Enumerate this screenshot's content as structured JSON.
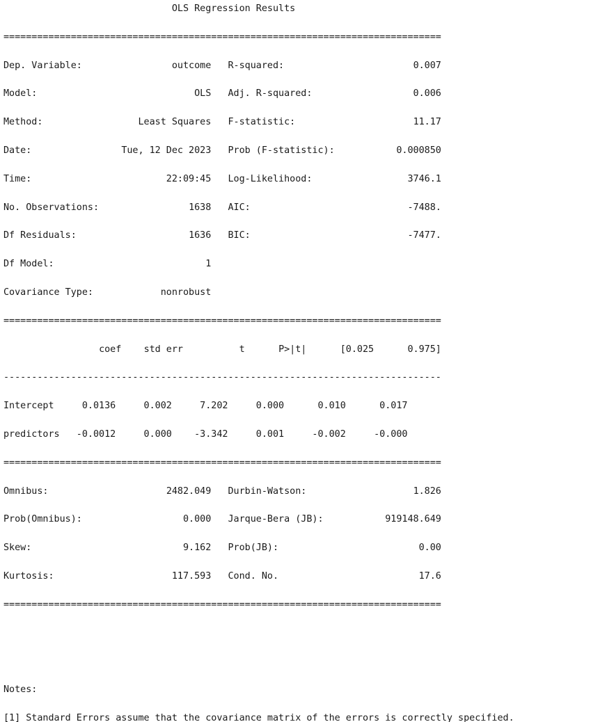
{
  "title": "OLS Regression Results",
  "separator_double": "==============================================================================",
  "separator_single": "------------------------------------------------------------------------------",
  "summary": {
    "left": [
      {
        "label": "Dep. Variable:",
        "value": "outcome"
      },
      {
        "label": "Model:",
        "value": "OLS"
      },
      {
        "label": "Method:",
        "value": "Least Squares"
      },
      {
        "label": "Date:",
        "value": "Tue, 12 Dec 2023"
      },
      {
        "label": "Time:",
        "value": "22:09:45"
      },
      {
        "label": "No. Observations:",
        "value": "1638"
      },
      {
        "label": "Df Residuals:",
        "value": "1636"
      },
      {
        "label": "Df Model:",
        "value": "1"
      },
      {
        "label": "Covariance Type:",
        "value": "nonrobust"
      }
    ],
    "right": [
      {
        "label": "R-squared:",
        "value": "0.007"
      },
      {
        "label": "Adj. R-squared:",
        "value": "0.006"
      },
      {
        "label": "F-statistic:",
        "value": "11.17"
      },
      {
        "label": "Prob (F-statistic):",
        "value": "0.000850"
      },
      {
        "label": "Log-Likelihood:",
        "value": "3746.1"
      },
      {
        "label": "AIC:",
        "value": "-7488."
      },
      {
        "label": "BIC:",
        "value": "-7477."
      }
    ]
  },
  "coefficients": {
    "headers": [
      "coef",
      "std err",
      "t",
      "P>|t|",
      "[0.025",
      "0.975]"
    ],
    "rows": [
      {
        "name": "Intercept",
        "values": [
          "0.0136",
          "0.002",
          "7.202",
          "0.000",
          "0.010",
          "0.017"
        ]
      },
      {
        "name": "predictors",
        "values": [
          "-0.0012",
          "0.000",
          "-3.342",
          "0.001",
          "-0.002",
          "-0.000"
        ]
      }
    ]
  },
  "diagnostics": {
    "left": [
      {
        "label": "Omnibus:",
        "value": "2482.049"
      },
      {
        "label": "Prob(Omnibus):",
        "value": "0.000"
      },
      {
        "label": "Skew:",
        "value": "9.162"
      },
      {
        "label": "Kurtosis:",
        "value": "117.593"
      }
    ],
    "right": [
      {
        "label": "Durbin-Watson:",
        "value": "1.826"
      },
      {
        "label": "Jarque-Bera (JB):",
        "value": "919148.649"
      },
      {
        "label": "Prob(JB):",
        "value": "0.00"
      },
      {
        "label": "Cond. No.",
        "value": "17.6"
      }
    ]
  },
  "notes": {
    "heading": "Notes:",
    "items": [
      "[1] Standard Errors assume that the covariance matrix of the errors is correctly specified."
    ]
  }
}
